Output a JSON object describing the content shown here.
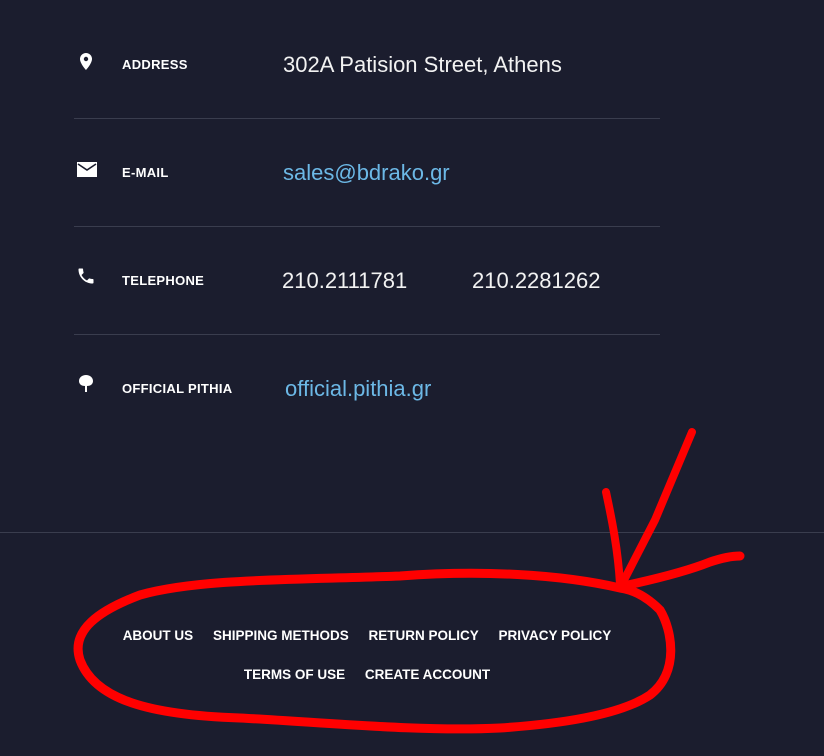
{
  "contact": {
    "address": {
      "label": "ADDRESS",
      "value": "302A Patision Street, Athens",
      "icon": "map-pin-icon"
    },
    "email": {
      "label": "E-MAIL",
      "value": "sales@bdrako.gr",
      "icon": "envelope-icon"
    },
    "telephone": {
      "label": "TELEPHONE",
      "values": [
        "210.2111781",
        "210.2281262"
      ],
      "icon": "phone-icon"
    },
    "pithia": {
      "label": "OFFICIAL PITHIA",
      "value": "official.pithia.gr",
      "icon": "tree-icon"
    }
  },
  "footer": {
    "links": [
      "ABOUT US",
      "SHIPPING METHODS",
      "RETURN POLICY",
      "PRIVACY POLICY",
      "TERMS OF USE",
      "CREATE ACCOUNT"
    ]
  },
  "colors": {
    "background": "#1b1d2e",
    "link": "#6cb8e6",
    "annotation": "#ff0000"
  }
}
